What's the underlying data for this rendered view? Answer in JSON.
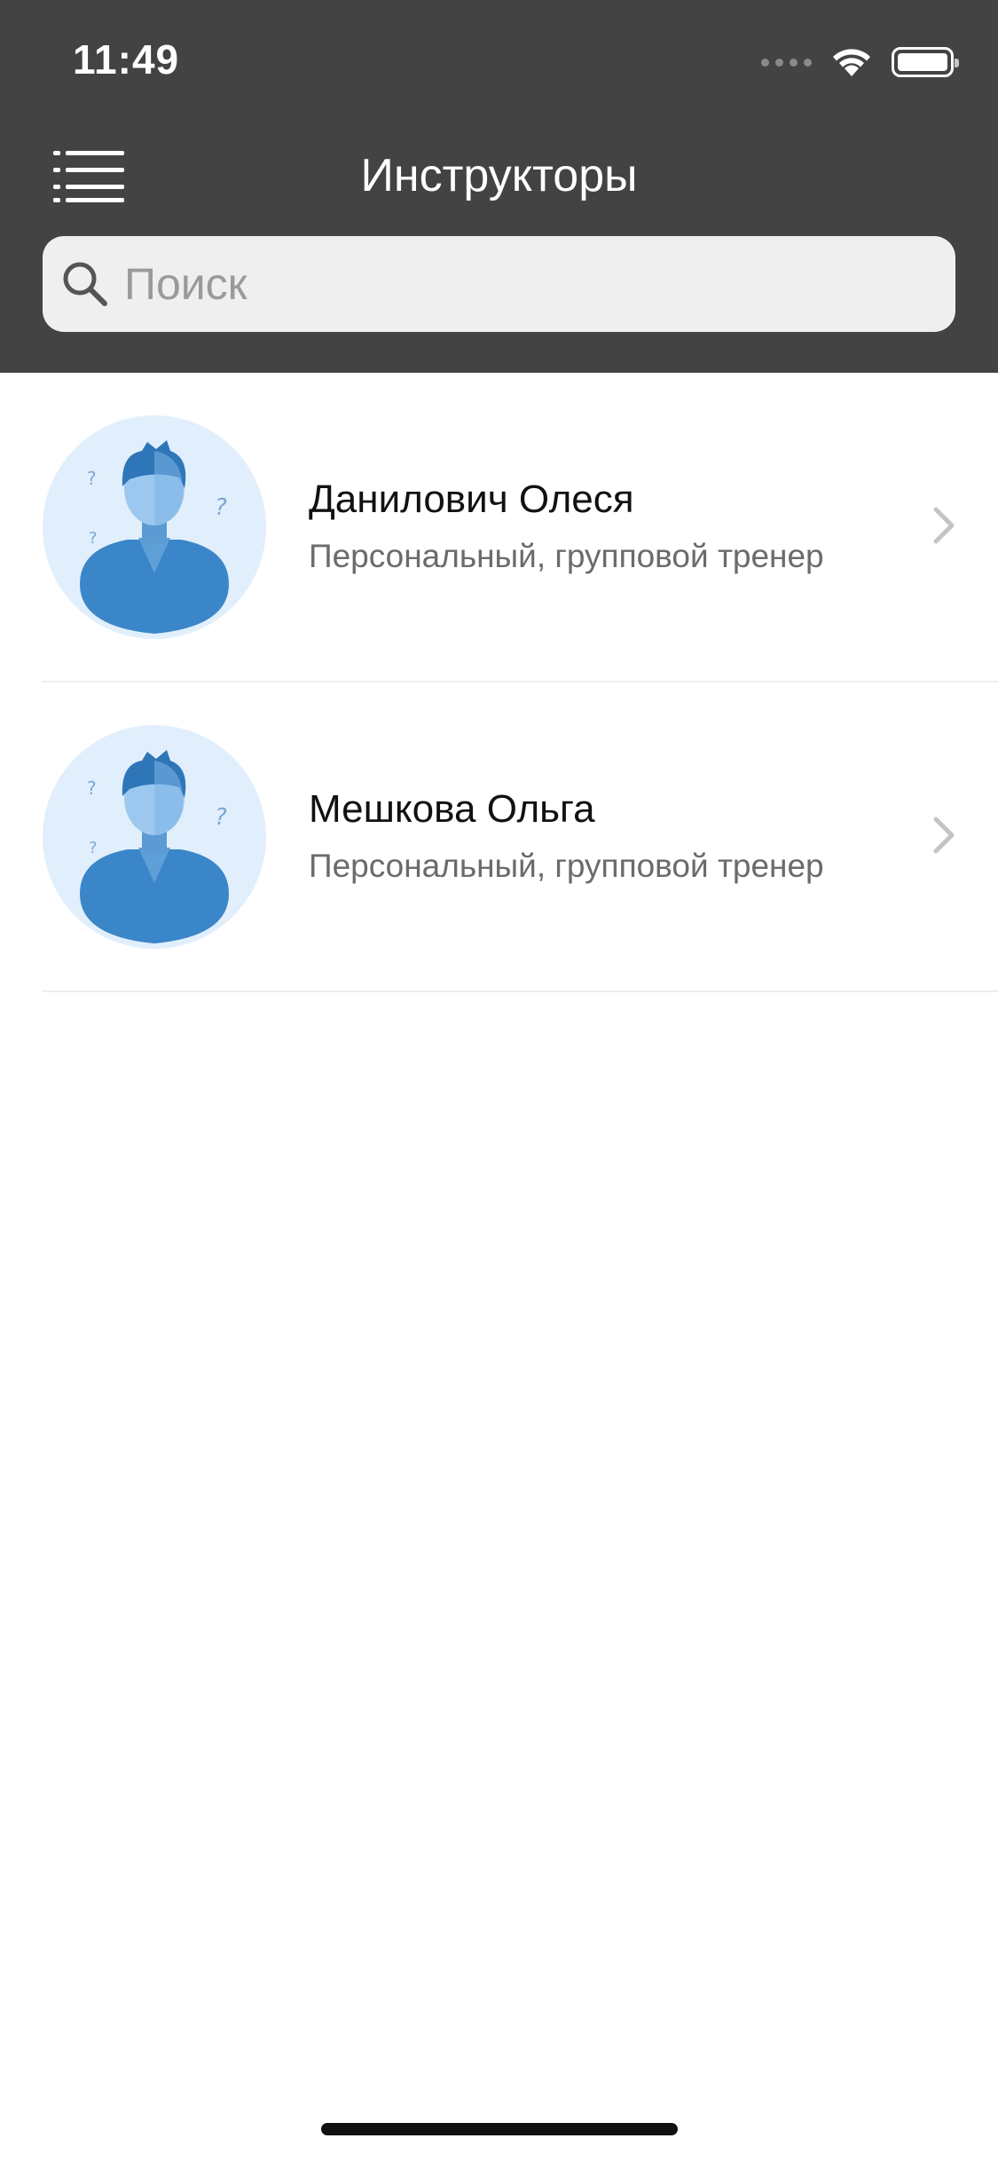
{
  "status_bar": {
    "time": "11:49"
  },
  "nav": {
    "title": "Инструкторы",
    "menu_icon": "list-menu-icon"
  },
  "search": {
    "placeholder": "Поиск",
    "value": "",
    "icon": "search-icon"
  },
  "instructors": [
    {
      "name": "Данилович Олеся",
      "role": "Персональный, групповой тренер"
    },
    {
      "name": "Мешкова Ольга",
      "role": "Персональный, групповой тренер"
    }
  ],
  "colors": {
    "header_bg": "#434343",
    "search_bg": "#efefef",
    "avatar_bg": "#e1effc",
    "avatar_figure": "#3a86c8"
  }
}
